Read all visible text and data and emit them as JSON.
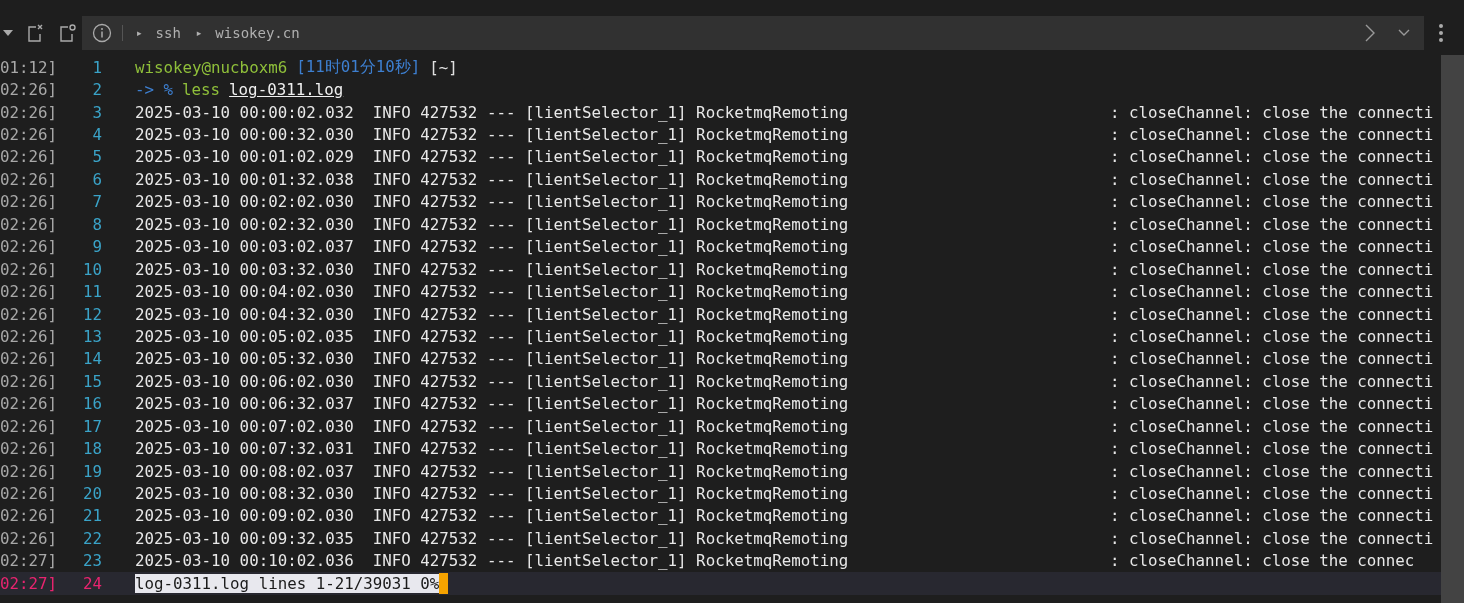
{
  "breadcrumb": {
    "items": [
      {
        "marker": "▸",
        "label": "ssh"
      },
      {
        "marker": "▸",
        "label": "wisokey.cn"
      }
    ]
  },
  "lines": [
    {
      "kind": "prompt",
      "stamp": "01:12]",
      "num": "1",
      "parts": [
        {
          "kind": "user",
          "text": "wisokey@nucboxm6"
        },
        {
          "kind": "time",
          "text": "[11时01分10秒]"
        },
        {
          "kind": "dir",
          "text": "[~]"
        }
      ]
    },
    {
      "kind": "command",
      "stamp": "02:26]",
      "num": "2",
      "prefix": "-> %",
      "cmd": "less",
      "arg": "log-0311.log"
    },
    {
      "kind": "log",
      "stamp": "02:26]",
      "num": "3",
      "text": "2025-03-10 00:00:02.032  INFO 427532 --- [lientSelector_1] RocketmqRemoting",
      "tail": ": closeChannel: close the connecti"
    },
    {
      "kind": "log",
      "stamp": "02:26]",
      "num": "4",
      "text": "2025-03-10 00:00:32.030  INFO 427532 --- [lientSelector_1] RocketmqRemoting",
      "tail": ": closeChannel: close the connecti"
    },
    {
      "kind": "log",
      "stamp": "02:26]",
      "num": "5",
      "text": "2025-03-10 00:01:02.029  INFO 427532 --- [lientSelector_1] RocketmqRemoting",
      "tail": ": closeChannel: close the connecti"
    },
    {
      "kind": "log",
      "stamp": "02:26]",
      "num": "6",
      "text": "2025-03-10 00:01:32.038  INFO 427532 --- [lientSelector_1] RocketmqRemoting",
      "tail": ": closeChannel: close the connecti"
    },
    {
      "kind": "log",
      "stamp": "02:26]",
      "num": "7",
      "text": "2025-03-10 00:02:02.030  INFO 427532 --- [lientSelector_1] RocketmqRemoting",
      "tail": ": closeChannel: close the connecti"
    },
    {
      "kind": "log",
      "stamp": "02:26]",
      "num": "8",
      "text": "2025-03-10 00:02:32.030  INFO 427532 --- [lientSelector_1] RocketmqRemoting",
      "tail": ": closeChannel: close the connecti"
    },
    {
      "kind": "log",
      "stamp": "02:26]",
      "num": "9",
      "text": "2025-03-10 00:03:02.037  INFO 427532 --- [lientSelector_1] RocketmqRemoting",
      "tail": ": closeChannel: close the connecti"
    },
    {
      "kind": "log",
      "stamp": "02:26]",
      "num": "10",
      "text": "2025-03-10 00:03:32.030  INFO 427532 --- [lientSelector_1] RocketmqRemoting",
      "tail": ": closeChannel: close the connecti"
    },
    {
      "kind": "log",
      "stamp": "02:26]",
      "num": "11",
      "text": "2025-03-10 00:04:02.030  INFO 427532 --- [lientSelector_1] RocketmqRemoting",
      "tail": ": closeChannel: close the connecti"
    },
    {
      "kind": "log",
      "stamp": "02:26]",
      "num": "12",
      "text": "2025-03-10 00:04:32.030  INFO 427532 --- [lientSelector_1] RocketmqRemoting",
      "tail": ": closeChannel: close the connecti"
    },
    {
      "kind": "log",
      "stamp": "02:26]",
      "num": "13",
      "text": "2025-03-10 00:05:02.035  INFO 427532 --- [lientSelector_1] RocketmqRemoting",
      "tail": ": closeChannel: close the connecti"
    },
    {
      "kind": "log",
      "stamp": "02:26]",
      "num": "14",
      "text": "2025-03-10 00:05:32.030  INFO 427532 --- [lientSelector_1] RocketmqRemoting",
      "tail": ": closeChannel: close the connecti"
    },
    {
      "kind": "log",
      "stamp": "02:26]",
      "num": "15",
      "text": "2025-03-10 00:06:02.030  INFO 427532 --- [lientSelector_1] RocketmqRemoting",
      "tail": ": closeChannel: close the connecti"
    },
    {
      "kind": "log",
      "stamp": "02:26]",
      "num": "16",
      "text": "2025-03-10 00:06:32.037  INFO 427532 --- [lientSelector_1] RocketmqRemoting",
      "tail": ": closeChannel: close the connecti"
    },
    {
      "kind": "log",
      "stamp": "02:26]",
      "num": "17",
      "text": "2025-03-10 00:07:02.030  INFO 427532 --- [lientSelector_1] RocketmqRemoting",
      "tail": ": closeChannel: close the connecti"
    },
    {
      "kind": "log",
      "stamp": "02:26]",
      "num": "18",
      "text": "2025-03-10 00:07:32.031  INFO 427532 --- [lientSelector_1] RocketmqRemoting",
      "tail": ": closeChannel: close the connecti"
    },
    {
      "kind": "log",
      "stamp": "02:26]",
      "num": "19",
      "text": "2025-03-10 00:08:02.037  INFO 427532 --- [lientSelector_1] RocketmqRemoting",
      "tail": ": closeChannel: close the connecti"
    },
    {
      "kind": "log",
      "stamp": "02:26]",
      "num": "20",
      "text": "2025-03-10 00:08:32.030  INFO 427532 --- [lientSelector_1] RocketmqRemoting",
      "tail": ": closeChannel: close the connecti"
    },
    {
      "kind": "log",
      "stamp": "02:26]",
      "num": "21",
      "text": "2025-03-10 00:09:02.030  INFO 427532 --- [lientSelector_1] RocketmqRemoting",
      "tail": ": closeChannel: close the connecti"
    },
    {
      "kind": "log",
      "stamp": "02:26]",
      "num": "22",
      "text": "2025-03-10 00:09:32.035  INFO 427532 --- [lientSelector_1] RocketmqRemoting",
      "tail": ": closeChannel: close the connecti"
    },
    {
      "kind": "log",
      "stamp": "02:27]",
      "num": "23",
      "text": "2025-03-10 00:10:02.036  INFO 427532 --- [lientSelector_1] RocketmqRemoting",
      "tail": ": closeChannel: close the connec"
    },
    {
      "kind": "status",
      "stamp": "02:27]",
      "num": "24",
      "text": "log-0311.log lines 1-21/39031 0%"
    }
  ]
}
